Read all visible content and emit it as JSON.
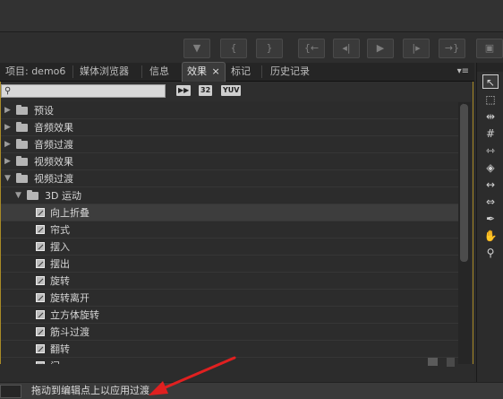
{
  "tabs": [
    {
      "label": "项目: demo6"
    },
    {
      "label": "媒体浏览器"
    },
    {
      "label": "信息"
    },
    {
      "label": "效果"
    },
    {
      "label": "标记"
    },
    {
      "label": "历史记录"
    }
  ],
  "panel_menu_glyph": "▾≡",
  "active_tab_close": "×",
  "search": {
    "value": "",
    "placeholder": ""
  },
  "filters": [
    {
      "label": "▶▶"
    },
    {
      "label": "32"
    },
    {
      "label": "YUV"
    }
  ],
  "tree": [
    {
      "label": "预设",
      "kind": "folder-preset",
      "expanded": false,
      "level": 0
    },
    {
      "label": "音频效果",
      "kind": "folder",
      "expanded": false,
      "level": 0
    },
    {
      "label": "音频过渡",
      "kind": "folder",
      "expanded": false,
      "level": 0
    },
    {
      "label": "视频效果",
      "kind": "folder",
      "expanded": false,
      "level": 0
    },
    {
      "label": "视频过渡",
      "kind": "folder",
      "expanded": true,
      "level": 0
    },
    {
      "label": "3D 运动",
      "kind": "folder",
      "expanded": true,
      "level": 1
    },
    {
      "label": "向上折叠",
      "kind": "effect",
      "level": 2,
      "selected": true
    },
    {
      "label": "帘式",
      "kind": "effect",
      "level": 2
    },
    {
      "label": "摆入",
      "kind": "effect",
      "level": 2
    },
    {
      "label": "摆出",
      "kind": "effect",
      "level": 2
    },
    {
      "label": "旋转",
      "kind": "effect",
      "level": 2
    },
    {
      "label": "旋转离开",
      "kind": "effect",
      "level": 2
    },
    {
      "label": "立方体旋转",
      "kind": "effect",
      "level": 2
    },
    {
      "label": "筋斗过渡",
      "kind": "effect",
      "level": 2
    },
    {
      "label": "翻转",
      "kind": "effect",
      "level": 2
    },
    {
      "label": "门",
      "kind": "effect",
      "level": 2
    }
  ],
  "status": {
    "text": "拖动到编辑点上以应用过渡"
  },
  "colors": {
    "panel_focus": "#a88a26",
    "annotation_arrow": "#e02020"
  },
  "transport_icons": [
    "marker-icon",
    "mark-in-icon",
    "mark-out-icon",
    "go-to-in-icon",
    "step-back-icon",
    "play-icon",
    "step-forward-icon",
    "go-to-out-icon",
    "export-frame-icon"
  ],
  "tool_icons": [
    "selection-tool-icon",
    "track-select-tool-icon",
    "ripple-edit-tool-icon",
    "rolling-edit-tool-icon",
    "rate-stretch-tool-icon",
    "razor-tool-icon",
    "slip-tool-icon",
    "slide-tool-icon",
    "pen-tool-icon",
    "hand-tool-icon",
    "zoom-tool-icon"
  ]
}
